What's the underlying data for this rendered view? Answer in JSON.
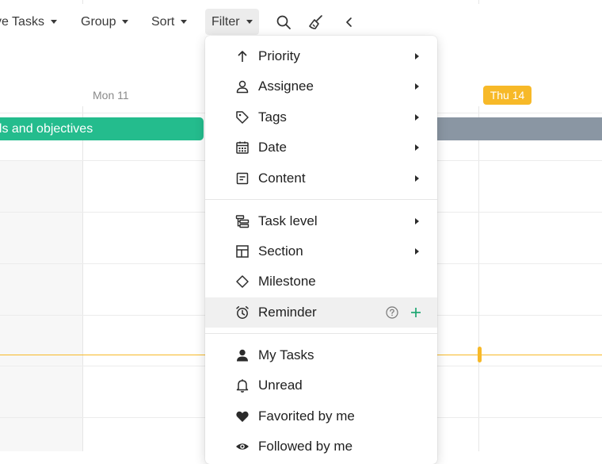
{
  "toolbar": {
    "tasks_label": "ve Tasks",
    "group_label": "Group",
    "sort_label": "Sort",
    "filter_label": "Filter"
  },
  "timeline": {
    "day_mon": "Mon 11",
    "day_thu": "Thu 14",
    "today_color": "#f7b928",
    "task_bar_label": "als and objectives",
    "task_bar_color": "#24bc8d",
    "section_bar_color": "#8a96a3"
  },
  "filter_menu": {
    "items": [
      {
        "label": "Priority",
        "icon": "arrow-up-icon",
        "submenu": true
      },
      {
        "label": "Assignee",
        "icon": "person-icon",
        "submenu": true
      },
      {
        "label": "Tags",
        "icon": "tag-icon",
        "submenu": true
      },
      {
        "label": "Date",
        "icon": "calendar-icon",
        "submenu": true
      },
      {
        "label": "Content",
        "icon": "document-icon",
        "submenu": true
      },
      {
        "label": "Task level",
        "icon": "hierarchy-icon",
        "submenu": true
      },
      {
        "label": "Section",
        "icon": "layout-icon",
        "submenu": true
      },
      {
        "label": "Milestone",
        "icon": "diamond-icon",
        "submenu": false
      },
      {
        "label": "Reminder",
        "icon": "alarm-clock-icon",
        "submenu": false,
        "highlighted": true,
        "help_icon": "question-circle-icon",
        "action_icon": "plus-icon"
      },
      {
        "label": "My Tasks",
        "icon": "person-filled-icon",
        "submenu": false
      },
      {
        "label": "Unread",
        "icon": "bell-icon",
        "submenu": false
      },
      {
        "label": "Favorited by me",
        "icon": "heart-icon",
        "submenu": false
      },
      {
        "label": "Followed by me",
        "icon": "eye-icon",
        "submenu": false
      }
    ]
  }
}
